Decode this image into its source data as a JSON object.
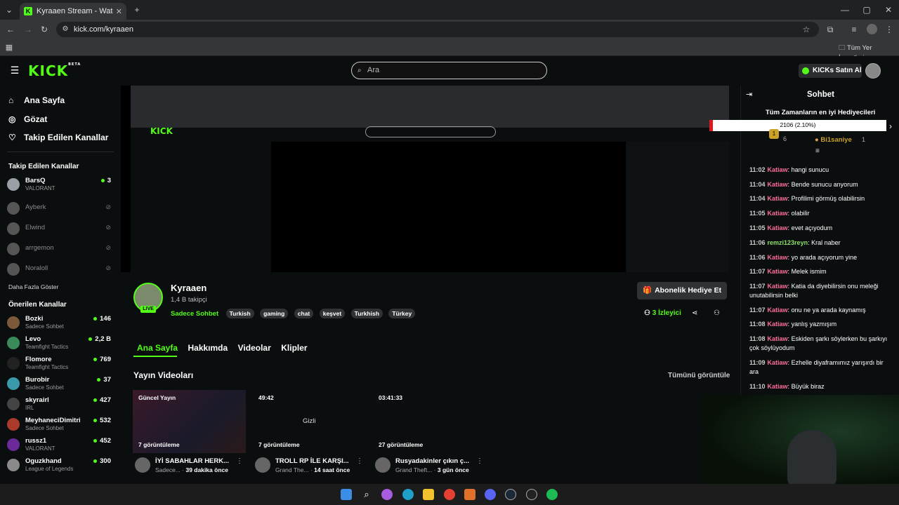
{
  "browser": {
    "tab_title": "Kyraaen Stream - Watch Live on",
    "url": "kick.com/kyraaen",
    "bookmarks_label": "Tüm Yer İşaretleri"
  },
  "header": {
    "logo": "KICK",
    "logo_sup": "BETA",
    "search_placeholder": "Ara",
    "kicks_button": "KICKs Satın Al"
  },
  "sidebar": {
    "nav": [
      {
        "label": "Ana Sayfa",
        "icon": "home-icon"
      },
      {
        "label": "Gözat",
        "icon": "compass-icon"
      },
      {
        "label": "Takip Edilen Kanallar",
        "icon": "heart-icon"
      }
    ],
    "followed_title": "Takip Edilen Kanallar",
    "followed": [
      {
        "name": "BarsQ",
        "sub": "VALORANT",
        "count": "3",
        "online": true
      },
      {
        "name": "Ayberk",
        "online": false
      },
      {
        "name": "Elwind",
        "online": false
      },
      {
        "name": "arrgemon",
        "online": false
      },
      {
        "name": "Noraloll",
        "online": false
      }
    ],
    "show_more": "Daha Fazla Göster",
    "recommended_title": "Önerilen Kanallar",
    "recommended": [
      {
        "name": "Bozki",
        "sub": "Sadece Sohbet",
        "count": "146"
      },
      {
        "name": "Levo",
        "sub": "Teamfight Tactics",
        "count": "2,2 B"
      },
      {
        "name": "Flomore",
        "sub": "Teamfight Tactics",
        "count": "769"
      },
      {
        "name": "Burobir",
        "sub": "Sadece Sohbet",
        "count": "37"
      },
      {
        "name": "skyrairl",
        "sub": "IRL",
        "count": "427"
      },
      {
        "name": "MeyhaneciDimitri",
        "sub": "Sadece Sohbet",
        "count": "532"
      },
      {
        "name": "russz1",
        "sub": "VALORANT",
        "count": "452"
      },
      {
        "name": "Oguzkhand",
        "sub": "League of Legends",
        "count": "300"
      }
    ]
  },
  "channel": {
    "name": "Kyraaen",
    "followers": "1,4 B takipçi",
    "live_badge": "LIVE",
    "category": "Sadece Sohbet",
    "tags": [
      "Turkish",
      "gaming",
      "chat",
      "keşvet",
      "Turkhish",
      "Türkey"
    ],
    "gift_button": "Abonelik Hediye Et",
    "viewers": "3",
    "viewers_label": "İzleyici"
  },
  "tabs": [
    "Ana Sayfa",
    "Hakkımda",
    "Videolar",
    "Klipler"
  ],
  "videos_section": {
    "title": "Yayın Videoları",
    "see_all": "Tümünü görüntüle",
    "videos": [
      {
        "badge": "Güncel Yayın",
        "views": "7 görüntüleme",
        "title": "İYİ SABAHLAR HERK...",
        "channel": "Sadece...",
        "age": "39 dakika önce"
      },
      {
        "badge": "49:42",
        "center": "Gizli",
        "views": "7 görüntüleme",
        "title": "TROLL RP İLE KARŞI...",
        "channel": "Grand The...",
        "age": "14 saat önce"
      },
      {
        "badge": "03:41:33",
        "views": "27 görüntüleme",
        "title": "Rusyadakinler çıkın ç...",
        "channel": "Grand Theft...",
        "age": "3 gün önce"
      }
    ]
  },
  "chat": {
    "title": "Sohbet",
    "gifters_title": "Tüm Zamanların en iyi Hediyecileri",
    "progress_text": "2106 (2.10%)",
    "gifter_count": "6",
    "gifter2_name": "Bi1saniye",
    "gifter2_count": "1",
    "messages": [
      {
        "time": "11:02",
        "user": "Katiaw",
        "text": "hangi sunucu",
        "color": "#ff6b9a"
      },
      {
        "time": "11:04",
        "user": "Katiaw",
        "text": "Bende sunucu anyorum",
        "color": "#ff6b9a"
      },
      {
        "time": "11:04",
        "user": "Katiaw",
        "text": "Profilimi görmüş olabilirsin",
        "color": "#ff6b9a"
      },
      {
        "time": "11:05",
        "user": "Katiaw",
        "text": "olabilir",
        "color": "#ff6b9a"
      },
      {
        "time": "11:05",
        "user": "Katiaw",
        "text": "evet açıyodum",
        "color": "#ff6b9a"
      },
      {
        "time": "11:06",
        "user": "remzi123reyn",
        "text": "Kral naber",
        "color": "#8ee06a"
      },
      {
        "time": "11:06",
        "user": "Katiaw",
        "text": "yo arada açıyorum yine",
        "color": "#ff6b9a"
      },
      {
        "time": "11:07",
        "user": "Katiaw",
        "text": "Melek ismim",
        "color": "#ff6b9a"
      },
      {
        "time": "11:07",
        "user": "Katiaw",
        "text": "Katia da diyebilirsin onu meleği unutabilirsin belki",
        "color": "#ff6b9a"
      },
      {
        "time": "11:07",
        "user": "Katiaw",
        "text": "onu ne ya arada kaynamış",
        "color": "#ff6b9a"
      },
      {
        "time": "11:08",
        "user": "Katiaw",
        "text": "yanlış yazmışım",
        "color": "#ff6b9a"
      },
      {
        "time": "11:08",
        "user": "Katiaw",
        "text": "Eskiden şarkı söylerken bu şarkıyı çok söylüyodum",
        "color": "#ff6b9a"
      },
      {
        "time": "11:09",
        "user": "Katiaw",
        "text": "Ezhelle diyaframımız yarışırdı bir ara",
        "color": "#ff6b9a"
      },
      {
        "time": "11:10",
        "user": "Katiaw",
        "text": "Büyük biraz",
        "color": "#ff6b9a"
      }
    ]
  },
  "colors": {
    "accent": "#53fc18",
    "chat_user": "#ff6b9a"
  }
}
